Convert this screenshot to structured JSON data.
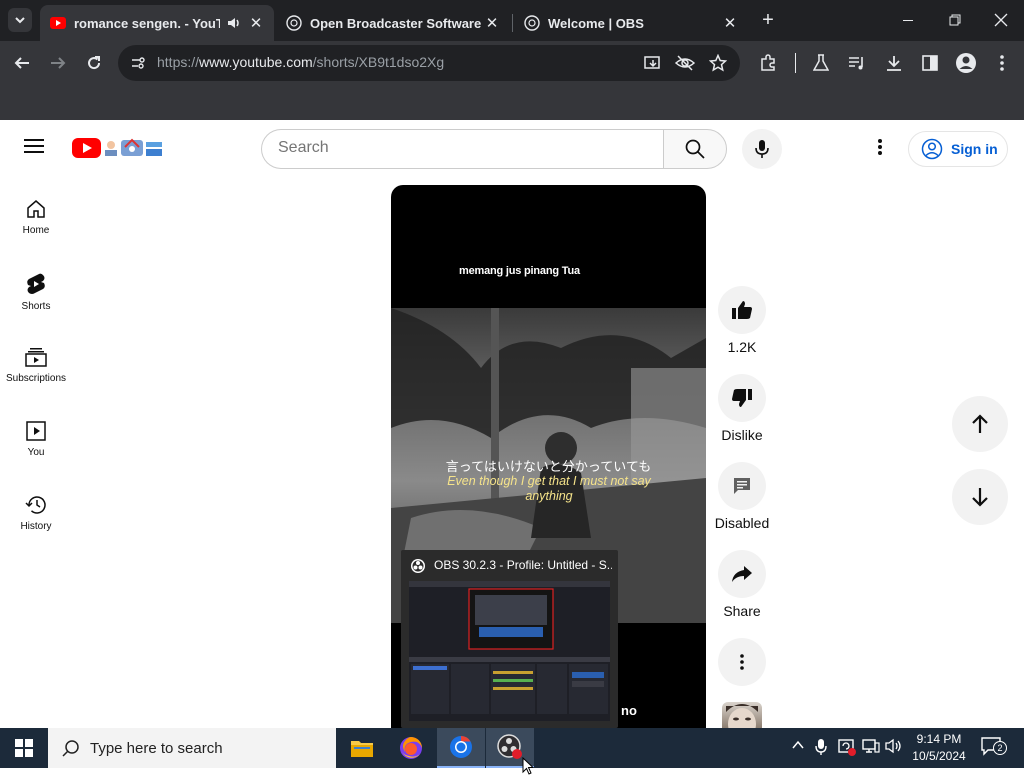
{
  "browser": {
    "tabs": [
      {
        "title": "romance sengen. - YouTube",
        "active": true,
        "audio": true
      },
      {
        "title": "Open Broadcaster Software | OBS",
        "active": false
      },
      {
        "title": "Welcome | OBS",
        "active": false
      }
    ],
    "new_tab": "+",
    "url": {
      "scheme": "https://",
      "host": "www.youtube.com",
      "path": "/shorts/XB9t1dso2Xg"
    }
  },
  "youtube": {
    "search_placeholder": "Search",
    "sign_in": "Sign in",
    "sidebar": [
      {
        "label": "Home",
        "icon": "home-icon"
      },
      {
        "label": "Shorts",
        "icon": "shorts-icon"
      },
      {
        "label": "Subscriptions",
        "icon": "subscriptions-icon"
      },
      {
        "label": "You",
        "icon": "you-icon"
      },
      {
        "label": "History",
        "icon": "history-icon"
      }
    ],
    "short": {
      "top_caption": "memang jus pinang Tua",
      "subtitle_jp": "言ってはいけないと分かっていても",
      "subtitle_en": "Even though I get that I must not say anything",
      "bottom_fragment": "no"
    },
    "actions": {
      "likes": "1.2K",
      "dislike": "Dislike",
      "comments": "Disabled",
      "share": "Share"
    }
  },
  "obs_preview": {
    "title": "OBS 30.2.3 - Profile: Untitled - S..."
  },
  "taskbar": {
    "search_placeholder": "Type here to search",
    "time": "9:14 PM",
    "date": "10/5/2024",
    "notifications": "2"
  },
  "colors": {
    "yt_red": "#ff0000",
    "link_blue": "#065fd4",
    "chrome_dark": "#202124",
    "taskbar": "#1c2a3a"
  }
}
